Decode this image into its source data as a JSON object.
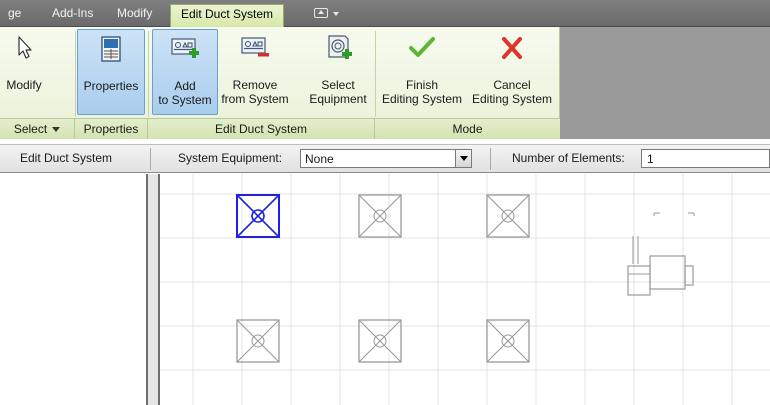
{
  "tabs": [
    {
      "label": "ge"
    },
    {
      "label": "Add-Ins"
    },
    {
      "label": "Modify"
    },
    {
      "label": "Edit Duct System",
      "active": true
    }
  ],
  "ribbon": {
    "buttons": {
      "modify": {
        "label": "Modify"
      },
      "properties": {
        "label": "Properties"
      },
      "add_to_system": {
        "line1": "Add",
        "line2": "to System"
      },
      "remove_from_system": {
        "line1": "Remove",
        "line2": "from System"
      },
      "select_equipment": {
        "line1": "Select",
        "line2": "Equipment"
      },
      "finish_editing_system": {
        "line1": "Finish",
        "line2": "Editing System"
      },
      "cancel_editing_system": {
        "line1": "Cancel",
        "line2": "Editing System"
      }
    },
    "panels": {
      "select": "Select",
      "properties": "Properties",
      "edit_duct_system": "Edit Duct System",
      "mode": "Mode"
    }
  },
  "options_bar": {
    "title": "Edit Duct System",
    "system_equipment_label": "System Equipment:",
    "system_equipment_value": "None",
    "number_of_elements_label": "Number of Elements:",
    "number_of_elements_value": "1"
  },
  "colors": {
    "selected_terminal": "#1e22e0",
    "unselected_terminal": "#9a9a9a",
    "finish_check": "#5fb533",
    "cancel_x": "#e0332b",
    "ribbon_green": "#e8f1d6"
  },
  "canvas": {
    "air_terminals": [
      {
        "selected": true
      },
      {
        "selected": false
      },
      {
        "selected": false
      },
      {
        "selected": false
      },
      {
        "selected": false
      },
      {
        "selected": false
      }
    ]
  }
}
